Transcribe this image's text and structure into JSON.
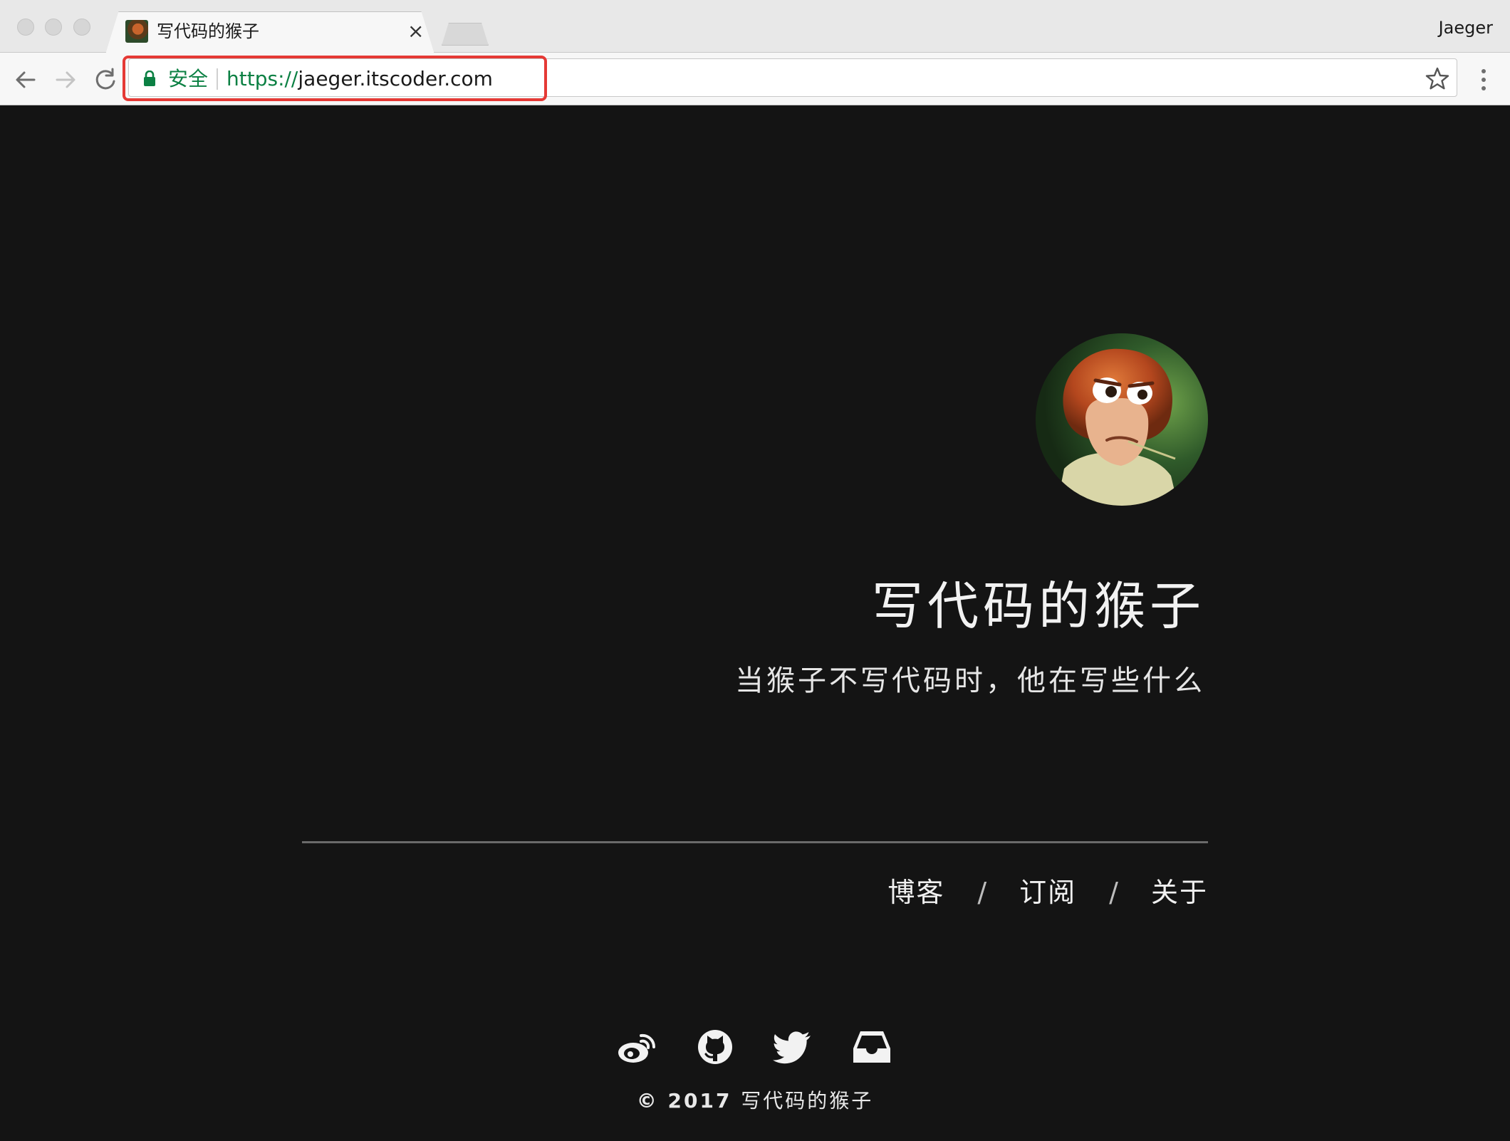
{
  "browser": {
    "tab_title": "写代码的猴子",
    "tab_close": "×",
    "profile_name": "Jaeger",
    "secure_label": "安全",
    "url_scheme": "https://",
    "url_host": "jaeger.itscoder.com",
    "icons": [
      "back-arrow-icon",
      "forward-arrow-icon",
      "reload-icon",
      "lock-icon",
      "star-icon",
      "kebab-menu-icon"
    ]
  },
  "site": {
    "title": "写代码的猴子",
    "subtitle": "当猴子不写代码时，他在写些什么",
    "nav": [
      "博客",
      "订阅",
      "关于"
    ],
    "nav_separator": "/",
    "social_icons": [
      "weibo-icon",
      "github-icon",
      "twitter-icon",
      "inbox-icon"
    ],
    "copyright_symbol": "© 2017",
    "copyright_name": "写代码的猴子"
  },
  "colors": {
    "page_background": "#141414",
    "secure_green": "#0b8043",
    "highlight_red": "#e53935"
  }
}
